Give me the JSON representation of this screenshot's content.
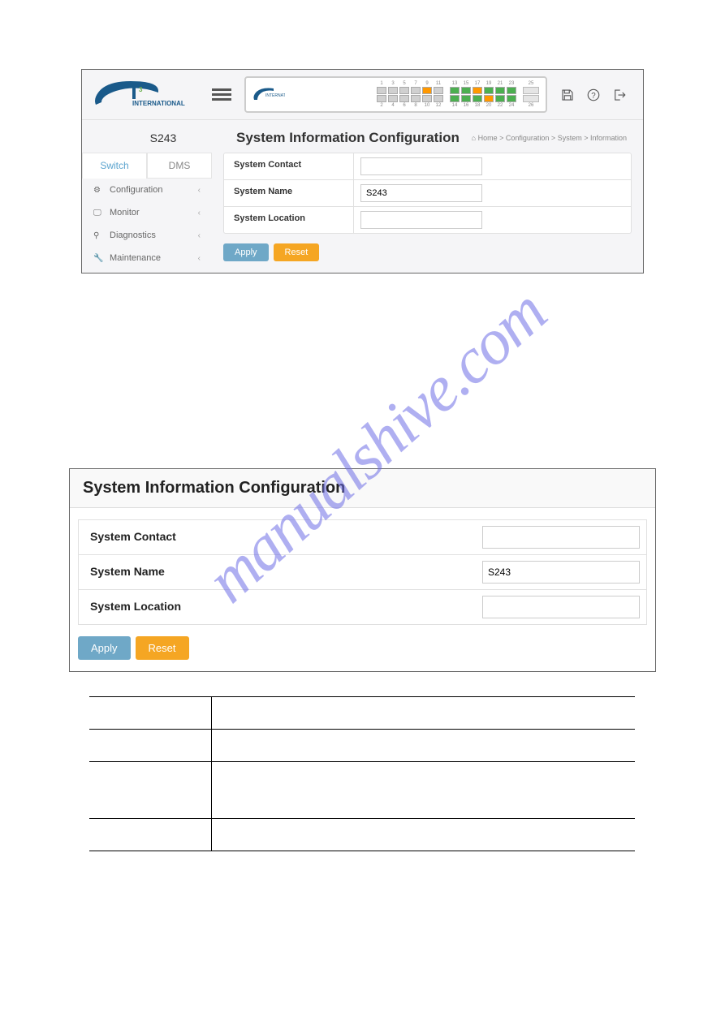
{
  "header": {
    "logo_text": "INTERNATIONAL",
    "logo_sup": "3"
  },
  "device_name": "S243",
  "tabs": {
    "switch": "Switch",
    "dms": "DMS"
  },
  "nav": {
    "configuration": "Configuration",
    "monitor": "Monitor",
    "diagnostics": "Diagnostics",
    "maintenance": "Maintenance"
  },
  "page_title": "System Information Configuration",
  "breadcrumb": {
    "home": "Home",
    "configuration": "Configuration",
    "system": "System",
    "information": "Information"
  },
  "form": {
    "system_contact_label": "System Contact",
    "system_contact_value": "",
    "system_name_label": "System Name",
    "system_name_value": "S243",
    "system_location_label": "System Location",
    "system_location_value": ""
  },
  "buttons": {
    "apply": "Apply",
    "reset": "Reset"
  },
  "watermark": "manualshive.com"
}
